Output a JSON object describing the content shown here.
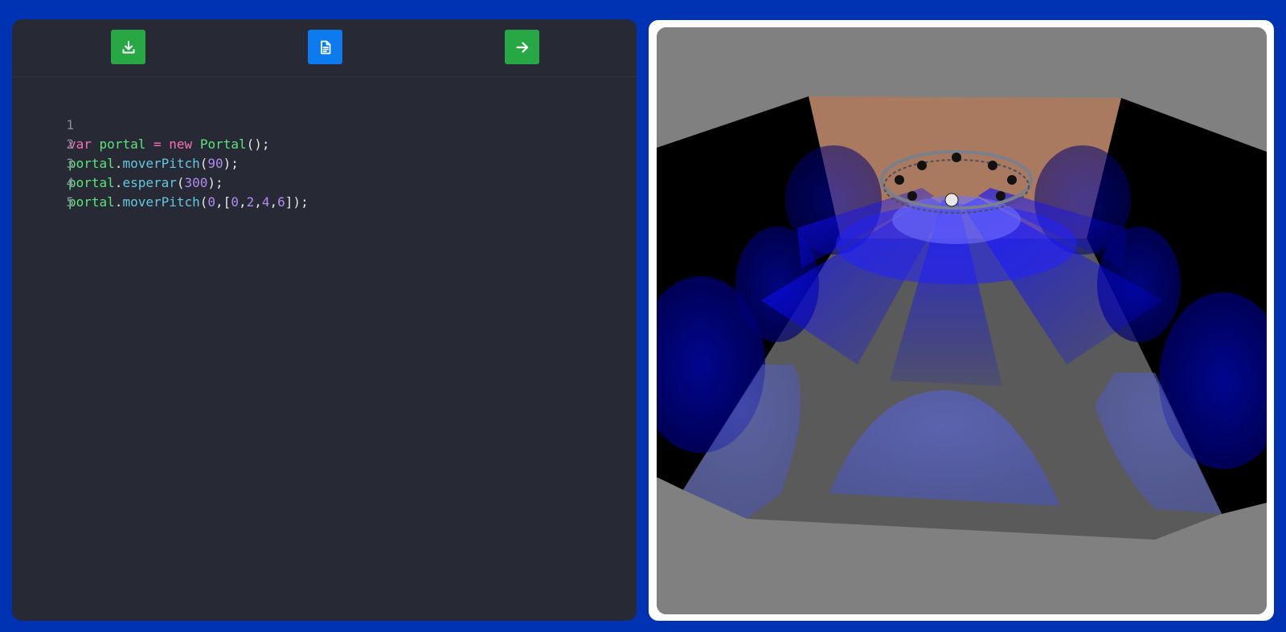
{
  "toolbar": {
    "download_icon": "download-icon",
    "file_icon": "file-text-icon",
    "run_icon": "arrow-right-icon",
    "colors": {
      "download": "#28a745",
      "file": "#0d7bf0",
      "run": "#28a745"
    }
  },
  "editor": {
    "lines": [
      {
        "number": "1",
        "text": "var portal = new Portal();"
      },
      {
        "number": "2",
        "text": "portal.moverPitch(90);"
      },
      {
        "number": "3",
        "text": "portal.esperar(300);"
      },
      {
        "number": "4",
        "text": "portal.moverPitch(0,[0,2,4,6]);"
      },
      {
        "number": "5",
        "text": ""
      }
    ]
  },
  "scene": {
    "description_icon": "stage-3d-view",
    "beam_color": "#0000ff",
    "floor_color": "#5a5a5a",
    "wall_color": "#000000",
    "ceiling_color": "#a97a5f"
  }
}
